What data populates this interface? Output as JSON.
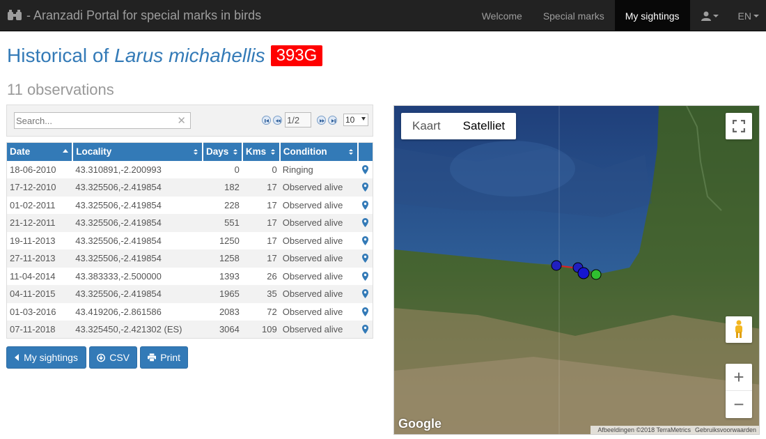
{
  "navbar": {
    "brand": "- Aranzadi Portal for special marks in birds",
    "items": [
      {
        "label": "Welcome"
      },
      {
        "label": "Special marks"
      },
      {
        "label": "My sightings"
      }
    ],
    "user_icon": "user-icon",
    "lang": "EN"
  },
  "title": {
    "prefix": "Historical of",
    "species": "Larus michahellis",
    "ring": "393G",
    "ring_color": "#ff0000"
  },
  "count": "11 observations",
  "search": {
    "placeholder": "Search...",
    "value": ""
  },
  "pager": {
    "page": "1/2",
    "per_page": "10"
  },
  "table": {
    "headers": [
      "Date",
      "Locality",
      "Days",
      "Kms",
      "Condition",
      ""
    ],
    "rows": [
      {
        "date": "18-06-2010",
        "loc": "43.310891,-2.200993",
        "days": "0",
        "kms": "0",
        "cond": "Ringing"
      },
      {
        "date": "17-12-2010",
        "loc": "43.325506,-2.419854",
        "days": "182",
        "kms": "17",
        "cond": "Observed alive"
      },
      {
        "date": "01-02-2011",
        "loc": "43.325506,-2.419854",
        "days": "228",
        "kms": "17",
        "cond": "Observed alive"
      },
      {
        "date": "21-12-2011",
        "loc": "43.325506,-2.419854",
        "days": "551",
        "kms": "17",
        "cond": "Observed alive"
      },
      {
        "date": "19-11-2013",
        "loc": "43.325506,-2.419854",
        "days": "1250",
        "kms": "17",
        "cond": "Observed alive"
      },
      {
        "date": "27-11-2013",
        "loc": "43.325506,-2.419854",
        "days": "1258",
        "kms": "17",
        "cond": "Observed alive"
      },
      {
        "date": "11-04-2014",
        "loc": "43.383333,-2.500000",
        "days": "1393",
        "kms": "26",
        "cond": "Observed alive"
      },
      {
        "date": "04-11-2015",
        "loc": "43.325506,-2.419854",
        "days": "1965",
        "kms": "35",
        "cond": "Observed alive"
      },
      {
        "date": "01-03-2016",
        "loc": "43.419206,-2.861586",
        "days": "2083",
        "kms": "72",
        "cond": "Observed alive"
      },
      {
        "date": "07-11-2018",
        "loc": "43.325450,-2.421302 (ES)",
        "days": "3064",
        "kms": "109",
        "cond": "Observed alive"
      }
    ]
  },
  "buttons": {
    "back": "My sightings",
    "csv": "CSV",
    "print": "Print"
  },
  "map": {
    "type_map": "Kaart",
    "type_sat": "Satelliet",
    "logo": "Google",
    "attribution": "Afbeeldingen ©2018 TerraMetrics",
    "terms": "Gebruiksvoorwaarden",
    "zoom_in": "+",
    "zoom_out": "−"
  },
  "colors": {
    "primary": "#337ab7",
    "navbar": "#222222"
  }
}
